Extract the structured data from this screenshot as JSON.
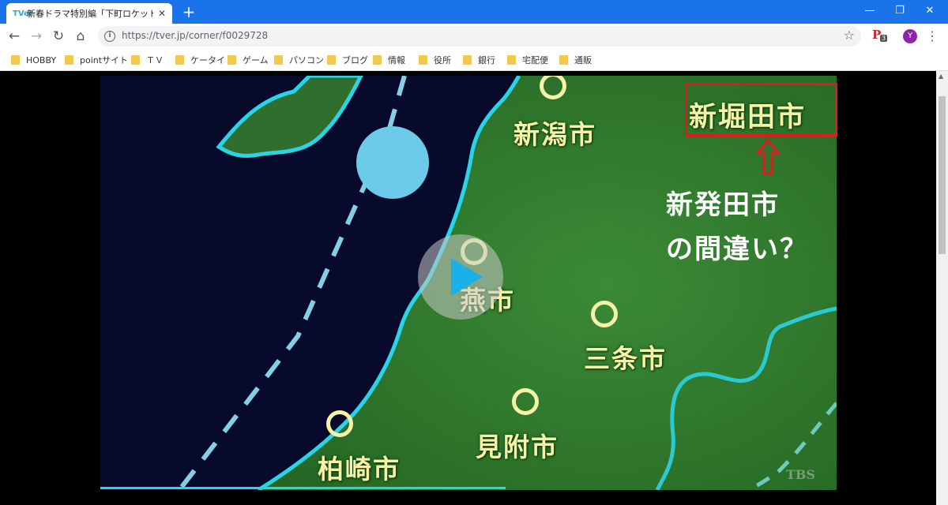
{
  "browser": {
    "tab": {
      "favicon": "TVer",
      "title": "新春ドラマ特別編「下町ロケット」| ",
      "close": "✕"
    },
    "new_tab": "+",
    "window_controls": {
      "minimize": "—",
      "restore": "❐",
      "close": "✕"
    },
    "nav": {
      "back": "←",
      "forward": "→",
      "reload": "↻",
      "home": "⌂"
    },
    "url": "https://tver.jp/corner/f0029728",
    "extension_badge": "3",
    "avatar_letter": "Y",
    "bookmarks": [
      "HOBBY",
      "pointサイト",
      "ＴＶ",
      "ケータイ",
      "ゲーム",
      "パソコン",
      "ブログ",
      "情報",
      "役所",
      "銀行",
      "宅配便",
      "通販"
    ]
  },
  "video": {
    "map_labels": {
      "niigata": "新潟市",
      "shinhorita": "新堀田市",
      "tsubame": "燕市",
      "sanjo": "三条市",
      "mitsuke": "見附市",
      "kashiwazaki": "柏崎市"
    },
    "annotation": {
      "line1": "新発田市",
      "line2": "の間違い？"
    },
    "watermark": "TBS",
    "progress_fraction": 0.55,
    "colors": {
      "sea": "#070a2a",
      "land": "#2f7a2e",
      "coast": "#2ad3e6",
      "label": "#f7f3a6",
      "highlight": "#e3191b"
    }
  }
}
